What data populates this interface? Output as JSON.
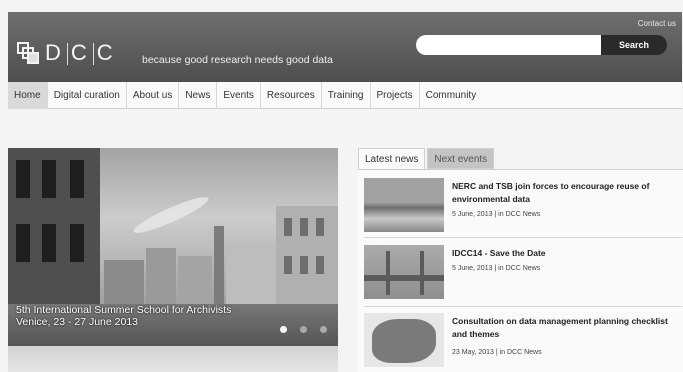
{
  "header": {
    "contact": "Contact us",
    "logo_text": "DCC",
    "tagline": "because good research needs good data",
    "search_button": "Search"
  },
  "nav": {
    "items": [
      "Home",
      "Digital curation",
      "About us",
      "News",
      "Events",
      "Resources",
      "Training",
      "Projects",
      "Community"
    ],
    "active": "Home"
  },
  "slider": {
    "caption_line1": "5th International Summer School for Archivists",
    "caption_line2": "Venice, 23 - 27 June 2013",
    "slides": 3,
    "active_slide": 1
  },
  "news": {
    "tabs": [
      "Latest news",
      "Next events"
    ],
    "active_tab": "Latest news",
    "items": [
      {
        "title": "NERC and TSB join forces to encourage reuse of environmental data",
        "meta": "5 June, 2013 | in DCC News"
      },
      {
        "title": "IDCC14 - Save the Date",
        "meta": "5 June, 2013 | in DCC News"
      },
      {
        "title": "Consultation on data management planning checklist and themes",
        "meta": "23 May, 2013 | in DCC News"
      }
    ]
  }
}
